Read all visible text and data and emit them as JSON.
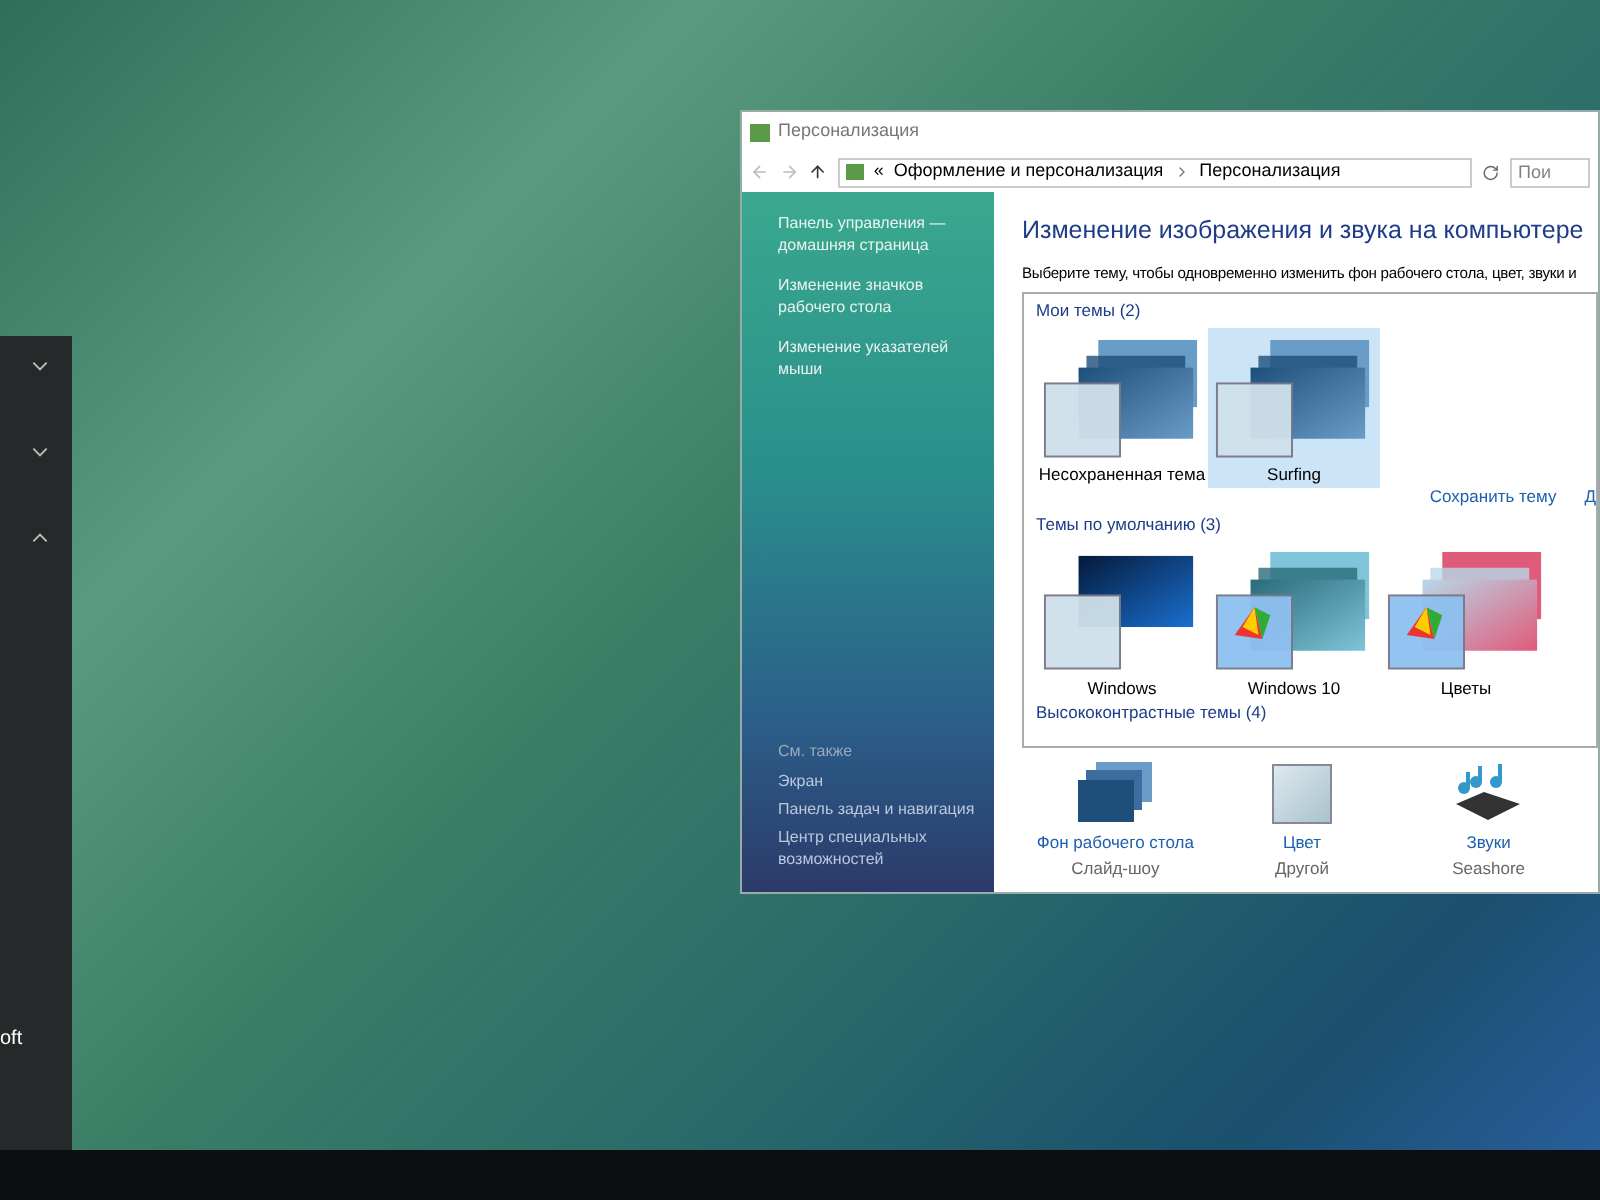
{
  "start_panel": {
    "arrows": [
      {
        "kind": "down"
      },
      {
        "kind": "down"
      },
      {
        "kind": "up"
      }
    ],
    "text": "oft"
  },
  "window": {
    "title": "Персонализация"
  },
  "address_bar": {
    "prefix": "«",
    "path": [
      "Оформление и персонализация",
      "Персонализация"
    ],
    "search_placeholder": "Пои"
  },
  "sidebar": {
    "links": [
      "Панель управления — домашняя страница",
      "Изменение значков рабочего стола",
      "Изменение указателей мыши"
    ],
    "see_also_heading": "См. также",
    "see_also_links": [
      "Экран",
      "Панель задач и навигация",
      "Центр специальных возможностей"
    ]
  },
  "heading": "Изменение изображения и звука на компьютере",
  "description": "Выберите тему, чтобы одновременно изменить фон рабочего стола, цвет, звуки и",
  "groups": [
    {
      "title": "Мои темы (2)",
      "themes": [
        {
          "name": "Несохраненная тема",
          "kind": "surf",
          "selected": false
        },
        {
          "name": "Surfing",
          "kind": "surf",
          "selected": true
        }
      ]
    },
    {
      "title": "Темы по умолчанию (3)",
      "themes": [
        {
          "name": "Windows",
          "kind": "windows",
          "selected": false
        },
        {
          "name": "Windows 10",
          "kind": "colors",
          "selected": false
        },
        {
          "name": "Цветы",
          "kind": "flowers",
          "selected": false
        }
      ]
    },
    {
      "title": "Высококонтрастные темы (4)"
    }
  ],
  "links": [
    "Сохранить тему",
    "Д"
  ],
  "bottom_items": [
    {
      "kind": "wallpaper",
      "label": "Фон рабочего стола",
      "sublabel": "Слайд-шоу"
    },
    {
      "kind": "color",
      "label": "Цвет",
      "sublabel": "Другой"
    },
    {
      "kind": "sounds",
      "label": "Звуки",
      "sublabel": "Seashore"
    }
  ]
}
